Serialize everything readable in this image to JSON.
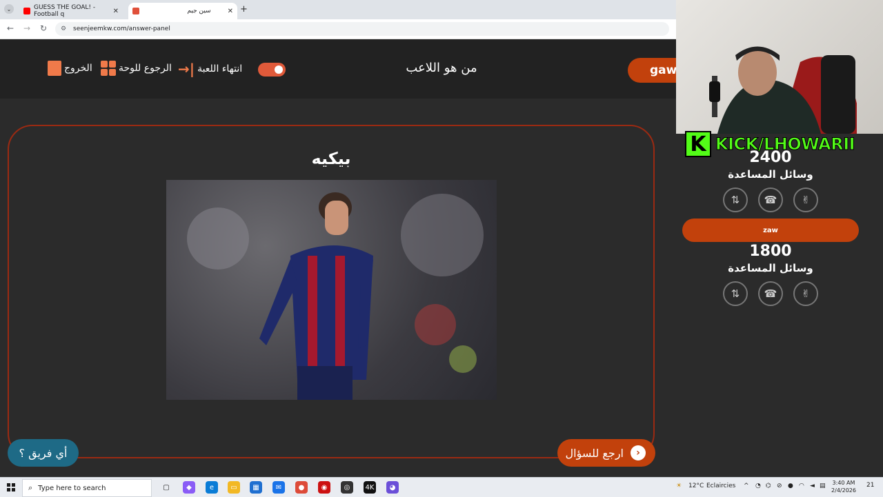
{
  "browser": {
    "tabs": [
      {
        "label": "GUESS THE GOAL! - Football q"
      },
      {
        "label": "سين جيم"
      }
    ],
    "url": "seenjeemkw.com/answer-panel"
  },
  "header": {
    "exit_label": "الخروج",
    "back_to_board_label": "الرجوع للوحة",
    "end_game_label": "انتهاء اللعبة",
    "question_title": "من هو اللاعب",
    "team_name": "gaw"
  },
  "main": {
    "answer": "بيكيه",
    "which_team_label": "أي فريق ؟",
    "back_to_question_label": "ارجع للسؤال"
  },
  "stream": {
    "kick_logo_letter": "K",
    "kick_handle": "KICK/LHOWARII"
  },
  "teams_panel": {
    "team1": {
      "score": "2400",
      "aids_label": "وسائل المساعدة"
    },
    "team2": {
      "name": "zaw",
      "score": "1800",
      "aids_label": "وسائل المساعدة"
    }
  },
  "taskbar": {
    "search_placeholder": "Type here to search",
    "weather_temp": "12°C",
    "weather_desc": "Eclaircies",
    "time": "3:40 AM",
    "date": "2/4/2026",
    "notification_count": "21"
  },
  "colors": {
    "accent": "#c2410c",
    "panel_border": "#9b2a12",
    "kick_green": "#53fc18",
    "team_button_blue": "#1e6a86"
  }
}
